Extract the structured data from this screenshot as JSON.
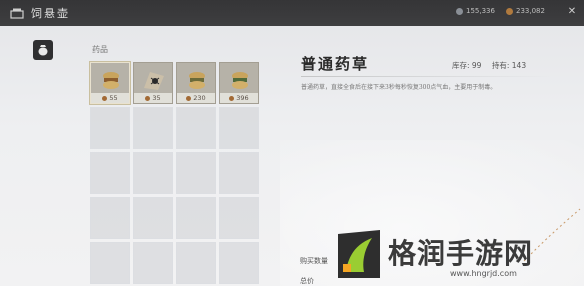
{
  "header": {
    "title": "饲悬壶",
    "currency_1": "155,336",
    "currency_2": "233,082",
    "colors": {
      "bar": "#3a3a3c",
      "coin_1": "#8a8f96",
      "coin_2": "#b07a3e"
    }
  },
  "tabs": [
    {
      "icon": "bag-icon"
    }
  ],
  "grid": {
    "label": "药品",
    "items": [
      {
        "name": "普通药草",
        "price": "55",
        "icon": "herb-bundle-icon"
      },
      {
        "name": "",
        "price": "35",
        "icon": "herb-spider-icon"
      },
      {
        "name": "",
        "price": "230",
        "icon": "herb-bundle-icon"
      },
      {
        "name": "",
        "price": "396",
        "icon": "herb-bundle-icon"
      }
    ]
  },
  "detail": {
    "name": "普通药草",
    "stock": "库存: 99",
    "owned": "持有: 143",
    "description": "普通药草，直接全食后在接下来3秒每秒恢复300点气血，主要用于制毒。"
  },
  "purchase": {
    "quantity_label": "购买数量",
    "total_label": "总价"
  },
  "watermark": {
    "text": "格润手游网",
    "url": "www.hngrjd.com"
  }
}
